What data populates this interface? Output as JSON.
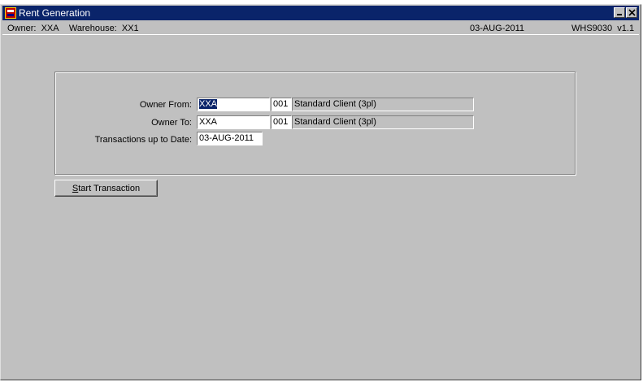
{
  "window": {
    "title": "Rent Generation"
  },
  "status": {
    "owner_label": "Owner:",
    "owner_value": "XXA",
    "warehouse_label": "Warehouse:",
    "warehouse_value": "XX1",
    "date": "03-AUG-2011",
    "module": "WHS9030",
    "version": "v1.1"
  },
  "form": {
    "owner_from_label": "Owner From:",
    "owner_from_code": "XXA",
    "owner_from_num": "001",
    "owner_from_desc": "Standard Client (3pl)",
    "owner_to_label": "Owner To:",
    "owner_to_code": "XXA",
    "owner_to_num": "001",
    "owner_to_desc": "Standard Client (3pl)",
    "date_label": "Transactions up to Date:",
    "date_value": "03-AUG-2011"
  },
  "actions": {
    "start_mnemonic": "S",
    "start_rest": "tart Transaction"
  },
  "icons": {
    "app": "oracle-forms-icon",
    "minimize": "minimize-icon",
    "close": "close-icon"
  },
  "colors": {
    "titlebar": "#0a246a",
    "window_bg": "#c0c0c0",
    "selection": "#0a246a"
  }
}
